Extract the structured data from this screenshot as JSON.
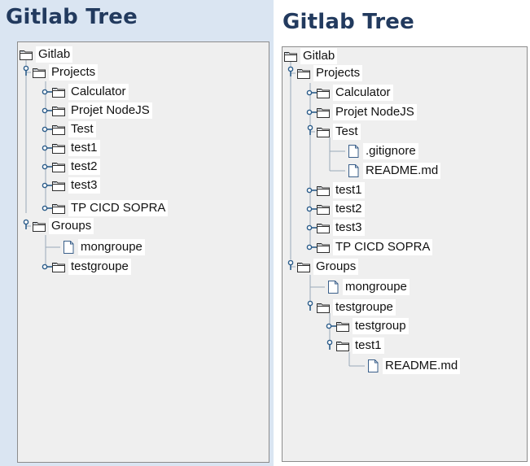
{
  "left_panel": {
    "title": "Gitlab Tree",
    "tree": {
      "root": "Gitlab",
      "projects": "Projects",
      "project_items": [
        "Calculator",
        "Projet NodeJS",
        "Test",
        "test1",
        "test2",
        "test3",
        "TP CICD SOPRA"
      ],
      "groups": "Groups",
      "group_items": [
        "mongroupe",
        "testgroupe"
      ]
    }
  },
  "right_panel": {
    "title": "Gitlab Tree",
    "tree": {
      "root": "Gitlab",
      "projects": "Projects",
      "project_items": [
        "Calculator",
        "Projet NodeJS",
        "Test",
        "test1",
        "test2",
        "test3",
        "TP CICD SOPRA"
      ],
      "test_files": [
        ".gitignore",
        "README.md"
      ],
      "groups": "Groups",
      "group_items": [
        "mongroupe",
        "testgroupe"
      ],
      "testgroupe_children": [
        "testgroup",
        "test1"
      ],
      "test1_files": [
        "README.md"
      ]
    }
  },
  "colors": {
    "left_bg": "#dae5f2",
    "title": "#223a5e",
    "tree_bg": "#efefef",
    "label_bg": "#ffffff",
    "handle": "#2b5c8a"
  },
  "icons": {
    "folder": "folder-icon",
    "file": "file-icon",
    "expanded": "expanded-handle-icon",
    "collapsed": "collapsed-handle-icon"
  }
}
